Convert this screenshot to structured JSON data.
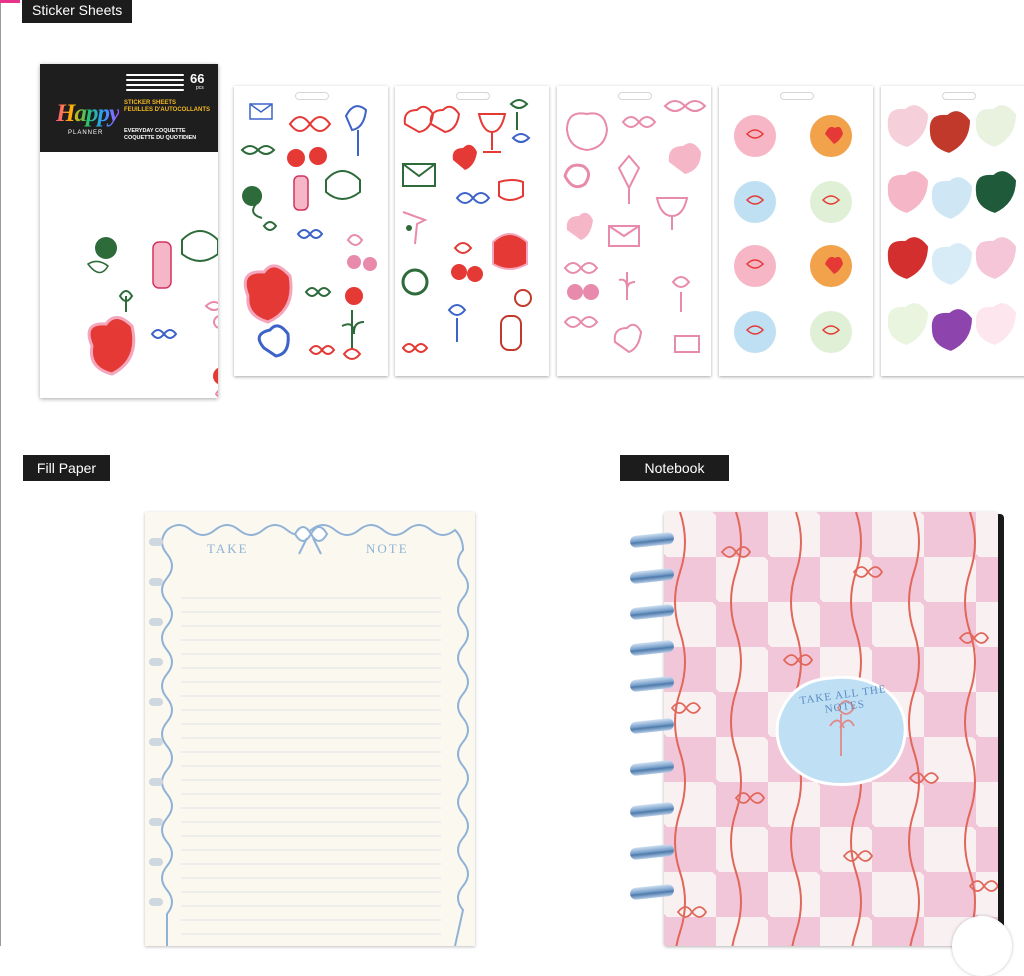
{
  "sections": {
    "stickers": {
      "label": "Sticker Sheets"
    },
    "fill_paper": {
      "label": "Fill Paper"
    },
    "notebook": {
      "label": "Notebook"
    }
  },
  "packaging": {
    "brand": "Happy",
    "sub_brand": "PLANNER",
    "count": "66",
    "count_unit": "pcs",
    "type_en": "STICKER SHEETS",
    "type_fr": "FEUILLES D'AUTOCOLLANTS",
    "collection_en": "EVERYDAY COQUETTE",
    "collection_fr": "COQUETTE DU QUOTIDIEN"
  },
  "fill_paper": {
    "header_left": "TAKE",
    "header_right": "NOTE"
  },
  "notebook": {
    "badge_text": "TAKE ALL THE NOTES"
  },
  "colors": {
    "label_bg": "#1c1c1c",
    "accent_pink": "#e8338a",
    "sticker_red": "#e53935",
    "sticker_green": "#2e6b3a",
    "sticker_blue": "#3d63c9",
    "sticker_pink": "#f2a3bd",
    "paper_blue": "#8fb2d6",
    "checker_pink": "#f2c6d9"
  }
}
